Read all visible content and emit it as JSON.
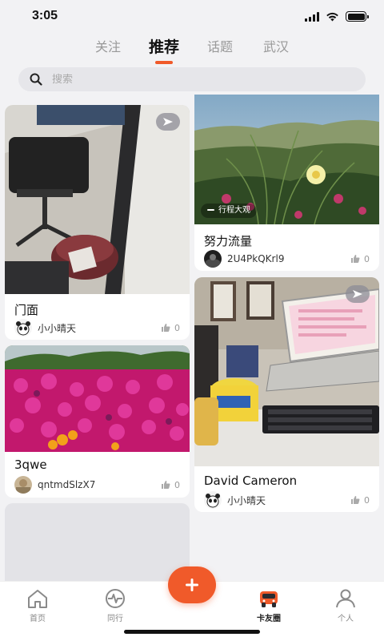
{
  "status_bar": {
    "time": "3:05",
    "battery_level": 1.0
  },
  "top_tabs": [
    {
      "label": "关注",
      "active": false
    },
    {
      "label": "推荐",
      "active": true
    },
    {
      "label": "话题",
      "active": false
    },
    {
      "label": "武汉",
      "active": false
    }
  ],
  "search": {
    "placeholder": "搜索",
    "icon": "search-icon"
  },
  "feed": {
    "left": [
      {
        "title": "门面",
        "author": "小小晴天",
        "likes": "0",
        "is_video": true,
        "photo": "office-chair-trash-bin"
      },
      {
        "title": "3qwe",
        "author": "qntmdSlzX7",
        "likes": "0",
        "is_video": false,
        "photo": "magenta-flower-bed"
      },
      {
        "title": "",
        "author": "",
        "likes": "",
        "is_video": false,
        "photo": "loading-placeholder"
      }
    ],
    "right": [
      {
        "title": "努力流量",
        "author": "2U4PkQKrl9",
        "likes": "0",
        "is_video": false,
        "location": "行程大观",
        "photo": "coastal-grass-flower"
      },
      {
        "title": "David Cameron",
        "author": "小小晴天",
        "likes": "0",
        "is_video": true,
        "photo": "laptop-desk-office"
      }
    ]
  },
  "bottom_nav": [
    {
      "label": "首页",
      "icon": "home-icon",
      "active": false
    },
    {
      "label": "同行",
      "icon": "activity-icon",
      "active": false
    },
    {
      "label": "卡友圈",
      "icon": "truck-icon",
      "active": true
    },
    {
      "label": "个人",
      "icon": "person-icon",
      "active": false
    }
  ],
  "fab": {
    "icon": "plus-icon"
  },
  "colors": {
    "accent": "#f05a2a",
    "background": "#f2f2f4"
  }
}
